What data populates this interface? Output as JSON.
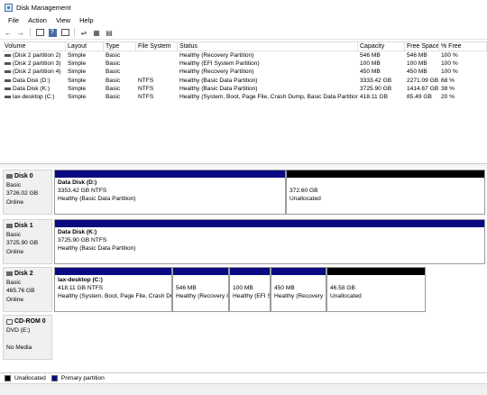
{
  "window": {
    "title": "Disk Management"
  },
  "menu": [
    "File",
    "Action",
    "View",
    "Help"
  ],
  "toolbar": {
    "icons": [
      "back-arrow-icon",
      "forward-arrow-icon",
      "console-tree-icon",
      "help-icon",
      "properties-icon",
      "refresh-icon",
      "connect-icon",
      "view-icon"
    ]
  },
  "columns": [
    "Volume",
    "Layout",
    "Type",
    "File System",
    "Status",
    "Capacity",
    "Free Space",
    "% Free"
  ],
  "volumes": [
    [
      "(Disk 2 partition 2)",
      "Simple",
      "Basic",
      "",
      "Healthy (Recovery Partition)",
      "546 MB",
      "546 MB",
      "100 %"
    ],
    [
      "(Disk 2 partition 3)",
      "Simple",
      "Basic",
      "",
      "Healthy (EFI System Partition)",
      "100 MB",
      "100 MB",
      "100 %"
    ],
    [
      "(Disk 2 partition 4)",
      "Simple",
      "Basic",
      "",
      "Healthy (Recovery Partition)",
      "450 MB",
      "450 MB",
      "100 %"
    ],
    [
      "Data Disk (D:)",
      "Simple",
      "Basic",
      "NTFS",
      "Healthy (Basic Data Partition)",
      "3333.42 GB",
      "2271.09 GB",
      "68 %"
    ],
    [
      "Data Disk (K:)",
      "Simple",
      "Basic",
      "NTFS",
      "Healthy (Basic Data Partition)",
      "3725.90 GB",
      "1414.67 GB",
      "38 %"
    ],
    [
      "lax-desktop (C:)",
      "Simple",
      "Basic",
      "NTFS",
      "Healthy (System, Boot, Page File, Crash Dump, Basic Data Partition)",
      "418.11 GB",
      "85.49 GB",
      "20 %"
    ]
  ],
  "disks": [
    {
      "name": "Disk 0",
      "type": "Basic",
      "size": "3726.02 GB",
      "state": "Online",
      "partitions": [
        {
          "kind": "primary",
          "name": "Data Disk  (D:)",
          "size": "3353.42 GB NTFS",
          "status": "Healthy (Basic Data Partition)"
        },
        {
          "kind": "unallocated",
          "name": "",
          "size": "372.60 GB",
          "status": "Unallocated"
        }
      ]
    },
    {
      "name": "Disk 1",
      "type": "Basic",
      "size": "3725.90 GB",
      "state": "Online",
      "partitions": [
        {
          "kind": "primary",
          "name": "Data Disk  (K:)",
          "size": "3725.90 GB NTFS",
          "status": "Healthy (Basic Data Partition)"
        }
      ]
    },
    {
      "name": "Disk 2",
      "type": "Basic",
      "size": "465.76 GB",
      "state": "Online",
      "partitions": [
        {
          "kind": "primary",
          "name": "lax-desktop  (C:)",
          "size": "418.11 GB NTFS",
          "status": "Healthy (System, Boot, Page File, Crash Du"
        },
        {
          "kind": "primary",
          "name": "",
          "size": "546 MB",
          "status": "Healthy (Recovery I"
        },
        {
          "kind": "primary",
          "name": "",
          "size": "100 MB",
          "status": "Healthy (EFI S"
        },
        {
          "kind": "primary",
          "name": "",
          "size": "450 MB",
          "status": "Healthy (Recovery"
        },
        {
          "kind": "unallocated",
          "name": "",
          "size": "46.58 GB",
          "status": "Unallocated"
        }
      ]
    },
    {
      "name": "CD-ROM 0",
      "type": "DVD (E:)",
      "size": "",
      "state": "No Media",
      "partitions": []
    }
  ],
  "legend": {
    "unallocated": "Unallocated",
    "primary": "Primary partition"
  },
  "colors": {
    "primary": "#0a0a82",
    "unallocated": "#000000"
  }
}
